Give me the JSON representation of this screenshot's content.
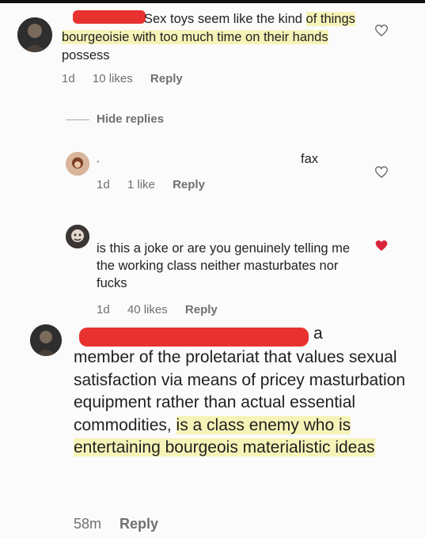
{
  "comments": [
    {
      "text_plain": "Sex toys seem like the kind",
      "text_hl": "of things bourgeoisie with too much time on their hands",
      "text_tail": "possess",
      "age": "1d",
      "likes": "10 likes",
      "reply": "Reply",
      "liked": false
    },
    {
      "text": "fax",
      "age": "1d",
      "likes": "1 like",
      "reply": "Reply",
      "liked": false
    },
    {
      "text": "is this a joke or are you genuinely telling me the working class neither masturbates nor fucks",
      "age": "1d",
      "likes": "40 likes",
      "reply": "Reply",
      "liked": true
    },
    {
      "text_head": "a",
      "text_plain": "member of the proletariat that values sexual satisfaction via means of pricey masturbation equipment rather than actual essential commodities,",
      "text_hl": "is a class enemy who is entertaining bourgeois materialistic ideas",
      "age": "58m",
      "reply": "Reply"
    }
  ],
  "hide_replies": "Hide replies",
  "colors": {
    "redaction": "#e8322f",
    "highlight": "#f6f3b8",
    "heart_liked": "#d9263e"
  }
}
